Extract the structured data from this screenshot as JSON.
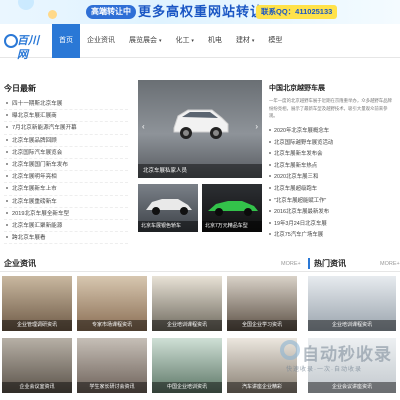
{
  "banner": {
    "pill": "高端转让中",
    "headline": "更多高权重网站转让",
    "contact": "联系QQ：411025133"
  },
  "header": {
    "logo_text": "百川网",
    "nav": [
      {
        "label": "首页",
        "active": true
      },
      {
        "label": "企业资讯"
      },
      {
        "label": "展览展会",
        "chevron": "▾"
      },
      {
        "label": "化工",
        "chevron": "▾"
      },
      {
        "label": "机电"
      },
      {
        "label": "建材",
        "chevron": "▾"
      },
      {
        "label": "模型"
      }
    ]
  },
  "news": {
    "title": "今日最新",
    "items": [
      "四十一期斯北京车展",
      "曝北京车展汇展商",
      "7月北京新能源汽车展开幕",
      "北京车展品牌回顾",
      "北京国际汽车展览会",
      "北京车展国门新车发布",
      "北京车展明年亮相",
      "北京车展新车上市",
      "北京车展重磅新车",
      "2019北京车展全新车型",
      "北京车展汇聚新能源",
      "跨北京车展看"
    ]
  },
  "slider": {
    "caption": "北京车展私家人员",
    "thumbs": [
      {
        "caption": "北京车展银色轿车"
      },
      {
        "caption": "北京7万元精品车型"
      }
    ]
  },
  "featured": {
    "title": "中国北京越野车展",
    "desc": "一年一度的北京越野车展于近期在京隆重举办，众多越野车品牌纷纷亮相，展示了最新车型及越野技术，吸引大量观众前来参观。",
    "items": [
      "2020年北京车展概念车",
      "北京国际越野车展览活动",
      "北京车展新车发布会",
      "北京车展新车热点",
      "2020北京车展三和",
      "北京车展超级跑车",
      "\"北京车展超能赋工作\"",
      "2016北京车展最新发布",
      "19年3月24日北京车展",
      "北京75汽车广场车展"
    ]
  },
  "sections": {
    "left_title": "企业资讯",
    "more": "MORE+",
    "right_title": "热门资讯",
    "right_more": "MORE+"
  },
  "cards": [
    {
      "caption": "企业管理调研资讯"
    },
    {
      "caption": "专家市场课程资讯"
    },
    {
      "caption": "企业培训课程资讯"
    },
    {
      "caption": "全国企业学习资讯"
    },
    {
      "caption": "企业会议室资讯"
    },
    {
      "caption": "学生家长研讨会资讯"
    },
    {
      "caption": "中国企业培训资讯"
    },
    {
      "caption": "汽车讲座企业精彩"
    }
  ],
  "side_cards": [
    {
      "caption": "企业培训课程资讯"
    },
    {
      "caption": "企业会议讲座资讯"
    }
  ],
  "watermark": {
    "title": "自动秒收录",
    "sub": "快速收录·一次·自动收录"
  }
}
